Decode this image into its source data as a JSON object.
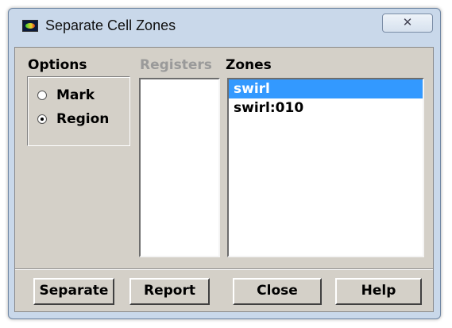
{
  "window": {
    "title": "Separate Cell Zones",
    "close_glyph": "✕"
  },
  "options": {
    "label": "Options",
    "radios": [
      {
        "label": "Mark",
        "checked": false
      },
      {
        "label": "Region",
        "checked": true
      }
    ]
  },
  "registers": {
    "label": "Registers",
    "items": []
  },
  "zones": {
    "label": "Zones",
    "items": [
      {
        "label": "swirl",
        "selected": true
      },
      {
        "label": "swirl:010",
        "selected": false
      }
    ]
  },
  "buttons": {
    "separate": "Separate",
    "report": "Report",
    "close": "Close",
    "help": "Help"
  },
  "colors": {
    "selection": "#3399ff",
    "dialog_face": "#d4d0c8",
    "frame": "#c9d8ea"
  }
}
